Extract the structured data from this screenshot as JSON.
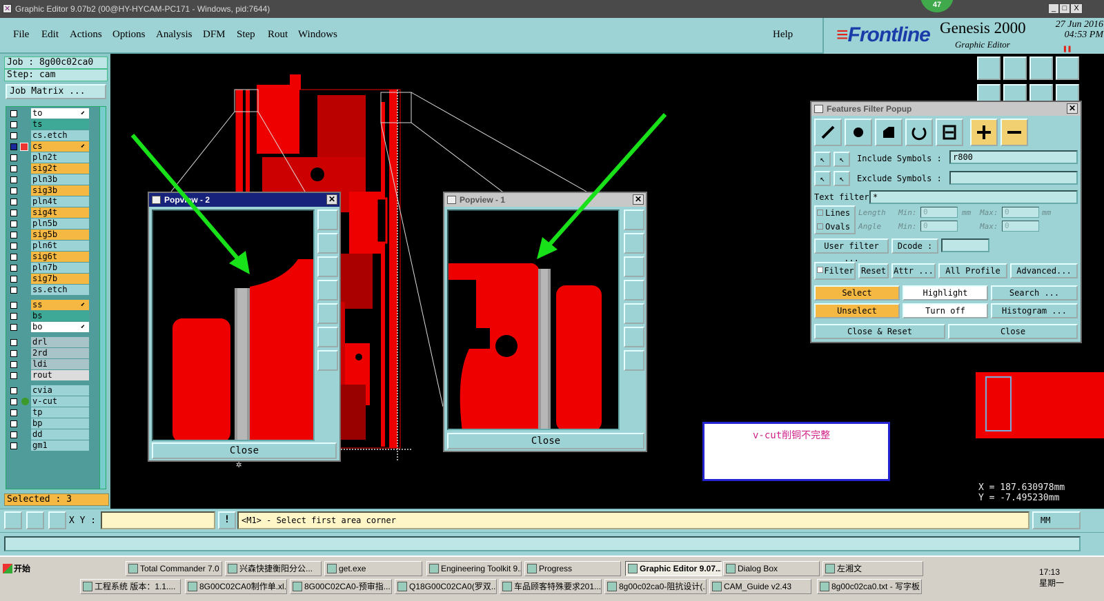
{
  "window": {
    "title": "Graphic Editor 9.07b2 (00@HY-HYCAM-PC171 - Windows, pid:7644)",
    "badge": "47",
    "controls": [
      "_",
      "□",
      "X"
    ]
  },
  "menu": {
    "items": [
      "File",
      "Edit",
      "Actions",
      "Options",
      "Analysis",
      "DFM",
      "Step",
      "Rout",
      "Windows"
    ],
    "help": "Help"
  },
  "brand": {
    "logo": "Frontline",
    "product": "Genesis 2000",
    "subtitle": "Graphic Editor",
    "date": "27 Jun 2016",
    "time": "04:53 PM"
  },
  "left_panel": {
    "job": "Job : 8g00c02ca0",
    "step": "Step: cam",
    "job_matrix": "Job Matrix ...",
    "layers": [
      {
        "name": "to",
        "color": "#ffffff",
        "mark": true
      },
      {
        "name": "ts",
        "color": "#3fa998"
      },
      {
        "name": "cs.etch",
        "color": "#9bd3d6"
      },
      {
        "name": "cs",
        "color": "#f5b843",
        "mark": true,
        "work": true
      },
      {
        "name": "pln2t",
        "color": "#9bd3d6"
      },
      {
        "name": "sig2t",
        "color": "#f5b843"
      },
      {
        "name": "pln3b",
        "color": "#9bd3d6"
      },
      {
        "name": "sig3b",
        "color": "#f5b843"
      },
      {
        "name": "pln4t",
        "color": "#9bd3d6"
      },
      {
        "name": "sig4t",
        "color": "#f5b843"
      },
      {
        "name": "pln5b",
        "color": "#9bd3d6"
      },
      {
        "name": "sig5b",
        "color": "#f5b843"
      },
      {
        "name": "pln6t",
        "color": "#9bd3d6"
      },
      {
        "name": "sig6t",
        "color": "#f5b843"
      },
      {
        "name": "pln7b",
        "color": "#9bd3d6"
      },
      {
        "name": "sig7b",
        "color": "#f5b843"
      },
      {
        "name": "ss.etch",
        "color": "#9bd3d6"
      },
      {
        "name": "ss",
        "color": "#f5b843",
        "mark": true
      },
      {
        "name": "bs",
        "color": "#3fa998"
      },
      {
        "name": "bo",
        "color": "#ffffff",
        "mark": true
      },
      {
        "name": "drl",
        "color": "#a9c4c9"
      },
      {
        "name": "2rd",
        "color": "#a9c4c9"
      },
      {
        "name": "ldi",
        "color": "#a9c4c9"
      },
      {
        "name": "rout",
        "color": "#dcdcdc"
      },
      {
        "name": "cvia",
        "color": "#9bd3d6"
      },
      {
        "name": "v-cut",
        "color": "#9bd3d6",
        "dot": true
      },
      {
        "name": "tp",
        "color": "#9bd3d6"
      },
      {
        "name": "bp",
        "color": "#9bd3d6"
      },
      {
        "name": "dd",
        "color": "#9bd3d6"
      },
      {
        "name": "gm1",
        "color": "#9bd3d6"
      }
    ],
    "selected": "Selected : 3"
  },
  "popview2": {
    "title": "Popview - 2",
    "close": "Close"
  },
  "popview1": {
    "title": "Popview - 1",
    "close": "Close"
  },
  "filter": {
    "title": "Features Filter Popup",
    "include_label": "Include Symbols :",
    "include_value": "r800",
    "exclude_label": "Exclude Symbols :",
    "exclude_value": "",
    "text_filter_label": "Text filter",
    "text_filter_value": "*",
    "lines": "Lines",
    "ovals": "Ovals",
    "length": "Length",
    "angle": "Angle",
    "min": "Min:",
    "max": "Max:",
    "min_len": "0",
    "max_len": "0",
    "min_ang": "0",
    "max_ang": "0",
    "unit_mm": "mm",
    "user_filter": "User filter ...",
    "dcode": "Dcode :",
    "filter": "Filter",
    "reset": "Reset",
    "attr": "Attr ...",
    "all_profile": "All Profile",
    "advanced": "Advanced...",
    "select": "Select",
    "highlight": "Highlight",
    "search": "Search ...",
    "unselect": "Unselect",
    "turn_off": "Turn off",
    "histogram": "Histogram ...",
    "close_reset": "Close & Reset",
    "close": "Close"
  },
  "annotation": "v-cut削铜不完整",
  "coords": {
    "x": "X = 187.630978mm",
    "y": "Y = -7.495230mm"
  },
  "command": {
    "xy_label": "X Y :",
    "xy_value": "",
    "message": "<M1> - Select first area corner",
    "units": "MM"
  },
  "taskbar": {
    "start": "开始",
    "row1": [
      "Total Commander 7.0 ...",
      "兴森快捷衡阳分公...",
      "get.exe",
      "Engineering Toolkit 9....",
      "Progress",
      "Graphic Editor 9.07...",
      "Dialog Box",
      "左湘文"
    ],
    "row2": [
      "工程系统  版本：1.1....",
      "8G00C02CA0制作单.xl...",
      "8G00C02CA0-预审指...",
      "Q18G00C02CA0(罗双...",
      "车品顾客特殊要求201...",
      "8g00c02ca0-阻抗设计(...",
      "CAM_Guide v2.43",
      "8g00c02ca0.txt - 写字板"
    ],
    "time": "17:13",
    "day": "星期一"
  }
}
